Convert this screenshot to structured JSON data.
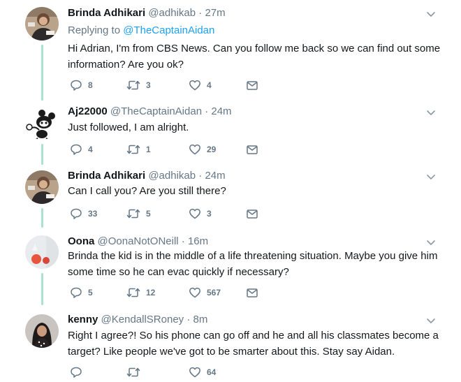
{
  "colors": {
    "thread_line": "#a9e3cf",
    "link": "#1da1f2",
    "muted": "#657786"
  },
  "tweets": [
    {
      "name": "Brinda Adhikari",
      "handle": "@adhikab",
      "sep": "·",
      "time": "27m",
      "reply_prefix": "Replying to ",
      "reply_to": "@TheCaptainAidan",
      "text": "Hi Adrian, I'm from CBS News. Can you follow me back so we can find out some information? Are you ok?",
      "replies": "8",
      "retweets": "3",
      "likes": "4",
      "avatar_icon": "profile-photo"
    },
    {
      "name": "Aj22000",
      "handle": "@TheCaptainAidan",
      "sep": "·",
      "time": "24m",
      "text": "Just followed, I am alright.",
      "replies": "4",
      "retweets": "1",
      "likes": "29",
      "avatar_icon": "cartoon-avatar"
    },
    {
      "name": "Brinda Adhikari",
      "handle": "@adhikab",
      "sep": "·",
      "time": "24m",
      "text": "Can I call you? Are you still there?",
      "replies": "33",
      "retweets": "5",
      "likes": "3",
      "avatar_icon": "profile-photo"
    },
    {
      "name": "Oona",
      "handle": "@OonaNotONeill",
      "sep": "·",
      "time": "16m",
      "text": "Brinda the kid is in the middle of a life threatening situation.  Maybe you give him some time so he can evac quickly if necessary?",
      "replies": "5",
      "retweets": "12",
      "likes": "567",
      "avatar_icon": "profile-photo"
    },
    {
      "name": "kenny",
      "handle": "@KendallSRoney",
      "sep": "·",
      "time": "8m",
      "text": "Right I agree?! So his phone can go off and he and all his classmates become a target? Like people we've got to be smarter about this. Stay say Aidan.",
      "replies": "",
      "retweets": "",
      "likes": "64",
      "avatar_icon": "profile-photo"
    }
  ]
}
